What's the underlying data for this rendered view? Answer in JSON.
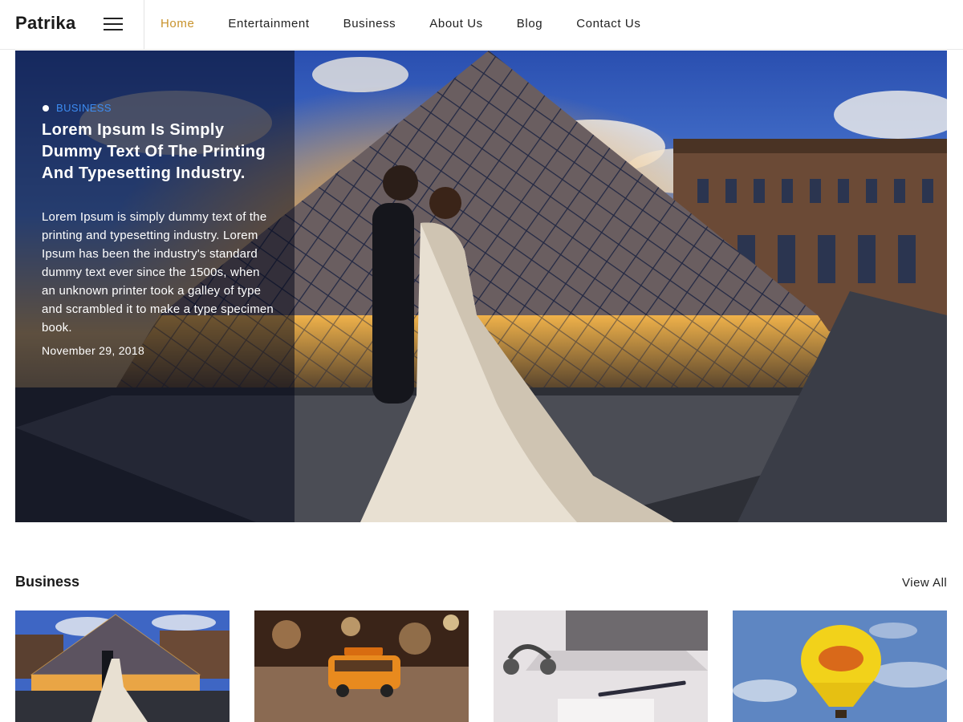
{
  "site": {
    "logo": "Patrika"
  },
  "nav": {
    "items": [
      "Home",
      "Entertainment",
      "Business",
      "About Us",
      "Blog",
      "Contact Us"
    ],
    "active_index": 0
  },
  "hero": {
    "category": "BUSINESS",
    "title": "Lorem Ipsum Is Simply Dummy Text Of The Printing And Typesetting Industry.",
    "excerpt": "Lorem Ipsum is simply dummy text of the printing and typesetting industry. Lorem Ipsum has been the industry's standard dummy text ever since the 1500s, when an unknown printer took a galley of type and scrambled it to make a type specimen book.",
    "date": "November 29, 2018"
  },
  "business": {
    "title": "Business",
    "view_all": "View All"
  },
  "colors": {
    "accent": "#c8922b",
    "category": "#3d8cf2"
  },
  "icons": {
    "menu": "hamburger-menu-icon",
    "bullet": "dot-icon"
  }
}
